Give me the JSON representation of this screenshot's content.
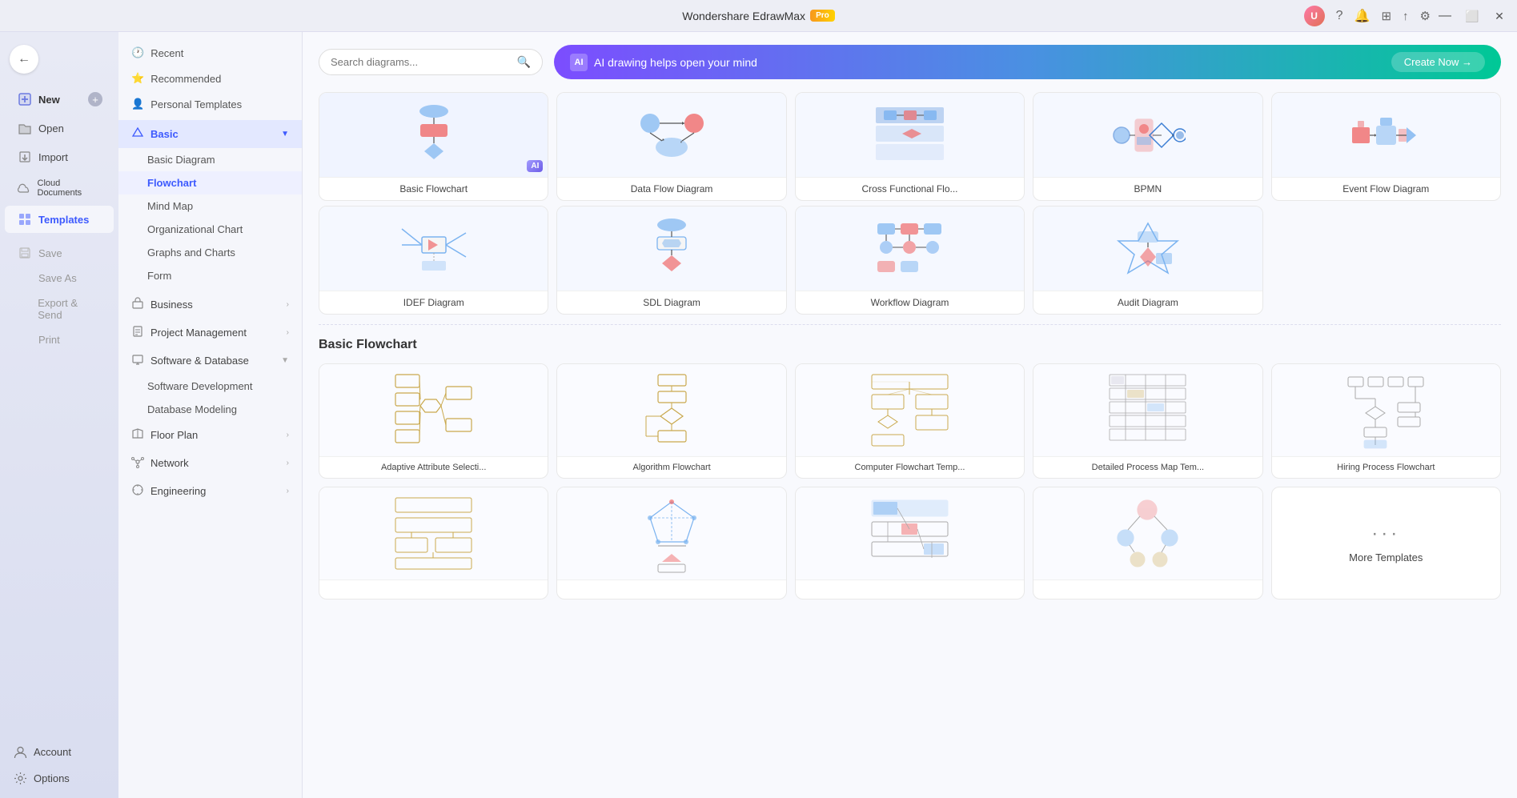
{
  "app": {
    "title": "Wondershare EdrawMax",
    "pro_badge": "Pro"
  },
  "window_controls": {
    "minimize": "—",
    "maximize": "⬜",
    "close": "✕"
  },
  "sidebar": {
    "back_label": "←",
    "items": [
      {
        "id": "new",
        "label": "New",
        "icon": "plus-square"
      },
      {
        "id": "open",
        "label": "Open",
        "icon": "folder"
      },
      {
        "id": "import",
        "label": "Import",
        "icon": "import"
      },
      {
        "id": "cloud",
        "label": "Cloud Documents",
        "icon": "cloud"
      },
      {
        "id": "templates",
        "label": "Templates",
        "icon": "grid",
        "active": true
      },
      {
        "id": "save",
        "label": "Save",
        "icon": "save"
      },
      {
        "id": "save-as",
        "label": "Save As",
        "icon": "save-as"
      },
      {
        "id": "export",
        "label": "Export & Send",
        "icon": "export"
      },
      {
        "id": "print",
        "label": "Print",
        "icon": "print"
      }
    ],
    "bottom_items": [
      {
        "id": "account",
        "label": "Account",
        "icon": "user"
      },
      {
        "id": "options",
        "label": "Options",
        "icon": "gear"
      }
    ]
  },
  "category_panel": {
    "items": [
      {
        "id": "recent",
        "label": "Recent",
        "icon": "clock",
        "type": "top"
      },
      {
        "id": "recommended",
        "label": "Recommended",
        "icon": "star",
        "type": "top"
      },
      {
        "id": "personal",
        "label": "Personal Templates",
        "icon": "person",
        "type": "top"
      },
      {
        "id": "basic",
        "label": "Basic",
        "icon": "diamond",
        "type": "category",
        "expanded": true
      },
      {
        "id": "basic-diagram",
        "label": "Basic Diagram",
        "type": "sub"
      },
      {
        "id": "flowchart",
        "label": "Flowchart",
        "type": "sub",
        "active": true
      },
      {
        "id": "mind-map",
        "label": "Mind Map",
        "type": "sub"
      },
      {
        "id": "org-chart",
        "label": "Organizational Chart",
        "type": "sub"
      },
      {
        "id": "graphs",
        "label": "Graphs and Charts",
        "type": "sub"
      },
      {
        "id": "form",
        "label": "Form",
        "type": "sub"
      },
      {
        "id": "business",
        "label": "Business",
        "icon": "briefcase",
        "type": "category"
      },
      {
        "id": "project",
        "label": "Project Management",
        "icon": "clipboard",
        "type": "category"
      },
      {
        "id": "software",
        "label": "Software & Database",
        "icon": "computer",
        "type": "category",
        "expanded": true
      },
      {
        "id": "software-dev",
        "label": "Software Development",
        "type": "sub"
      },
      {
        "id": "database",
        "label": "Database Modeling",
        "type": "sub"
      },
      {
        "id": "floor",
        "label": "Floor Plan",
        "icon": "home",
        "type": "category"
      },
      {
        "id": "network",
        "label": "Network",
        "icon": "network",
        "type": "category"
      },
      {
        "id": "engineering",
        "label": "Engineering",
        "icon": "wrench",
        "type": "category"
      }
    ]
  },
  "search": {
    "placeholder": "Search diagrams..."
  },
  "ai_banner": {
    "icon": "AI",
    "text": "AI drawing helps open your mind",
    "button": "Create Now →"
  },
  "diagram_section": {
    "diagrams": [
      {
        "id": "basic-flowchart",
        "label": "Basic Flowchart",
        "has_ai": true
      },
      {
        "id": "data-flow",
        "label": "Data Flow Diagram"
      },
      {
        "id": "cross-functional",
        "label": "Cross Functional Flo..."
      },
      {
        "id": "bpmn",
        "label": "BPMN"
      },
      {
        "id": "event-flow",
        "label": "Event Flow Diagram"
      },
      {
        "id": "idef",
        "label": "IDEF Diagram"
      },
      {
        "id": "sdl",
        "label": "SDL Diagram"
      },
      {
        "id": "workflow",
        "label": "Workflow Diagram"
      },
      {
        "id": "audit",
        "label": "Audit Diagram"
      }
    ]
  },
  "template_section": {
    "title": "Basic Flowchart",
    "templates": [
      {
        "id": "adaptive",
        "label": "Adaptive Attribute Selecti..."
      },
      {
        "id": "algorithm",
        "label": "Algorithm Flowchart"
      },
      {
        "id": "computer-flowchart",
        "label": "Computer Flowchart Temp..."
      },
      {
        "id": "detailed-process",
        "label": "Detailed Process Map Tem..."
      },
      {
        "id": "hiring-process",
        "label": "Hiring Process Flowchart"
      },
      {
        "id": "row2-1",
        "label": ""
      },
      {
        "id": "row2-2",
        "label": ""
      },
      {
        "id": "row2-3",
        "label": ""
      },
      {
        "id": "row2-4",
        "label": ""
      }
    ],
    "more_label": "More Templates",
    "more_dots": "···"
  },
  "top_right": {
    "icons": [
      "help",
      "bell",
      "apps",
      "upload",
      "settings"
    ]
  }
}
